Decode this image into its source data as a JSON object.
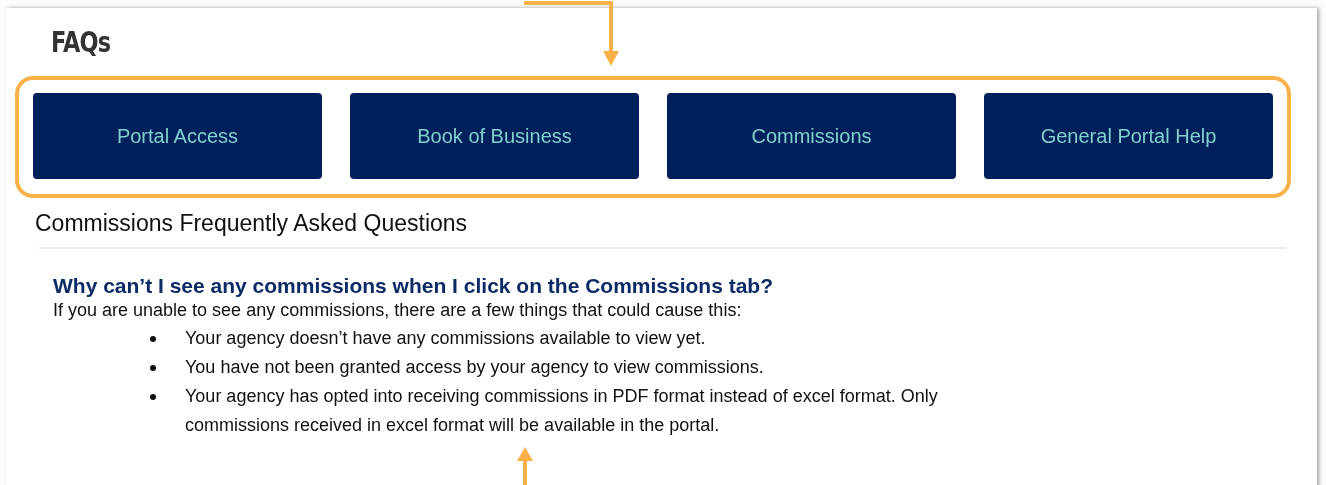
{
  "page_title": "FAQs",
  "categories": [
    {
      "label": "Portal Access"
    },
    {
      "label": "Book of Business"
    },
    {
      "label": "Commissions"
    },
    {
      "label": "General Portal Help"
    }
  ],
  "section_title": "Commissions Frequently Asked Questions",
  "faq": {
    "question": "Why can’t I see any commissions when I click on the Commissions tab?",
    "answer": "If you are unable to see any commissions, there are a few things that could cause this:",
    "bullets": [
      "Your agency doesn’t have any commissions available to view yet.",
      "You have not been granted access by your agency to view commissions.",
      "Your agency has opted into receiving commissions in PDF format instead of excel format. Only commissions received in excel format will be available in the portal."
    ]
  }
}
